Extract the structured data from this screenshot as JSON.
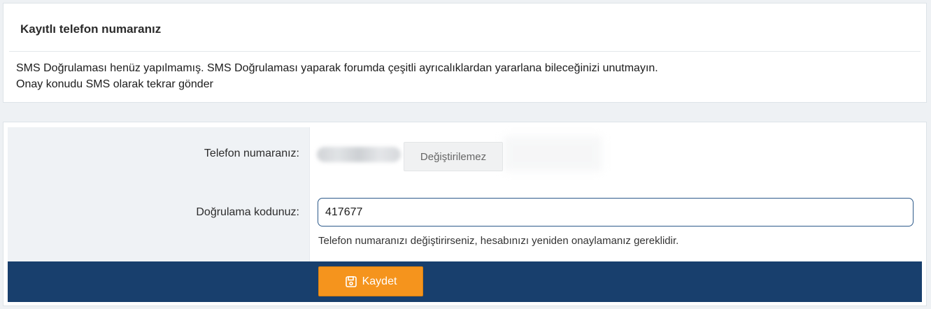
{
  "info": {
    "title": "Kayıtlı telefon numaranız",
    "message": "SMS Doğrulaması henüz yapılmamış. SMS Doğrulaması yaparak forumda çeşitli ayrıcalıklardan yararlana bileceğinizi unutmayın.",
    "resend_link": "Onay konudu SMS olarak tekrar gönder"
  },
  "form": {
    "phone_label": "Telefon numaranız:",
    "phone_locked_button": "Değiştirilemez",
    "code_label": "Doğrulama kodunuz:",
    "code_value": "417677",
    "hint": "Telefon numaranızı değiştirirseniz, hesabınızı yeniden onaylamanız gereklidir.",
    "save_button": "Kaydet",
    "save_icon": "save-icon"
  },
  "colors": {
    "footer_bar": "#183f6d",
    "save_button": "#f5941d",
    "input_border": "#2d5a8a"
  }
}
